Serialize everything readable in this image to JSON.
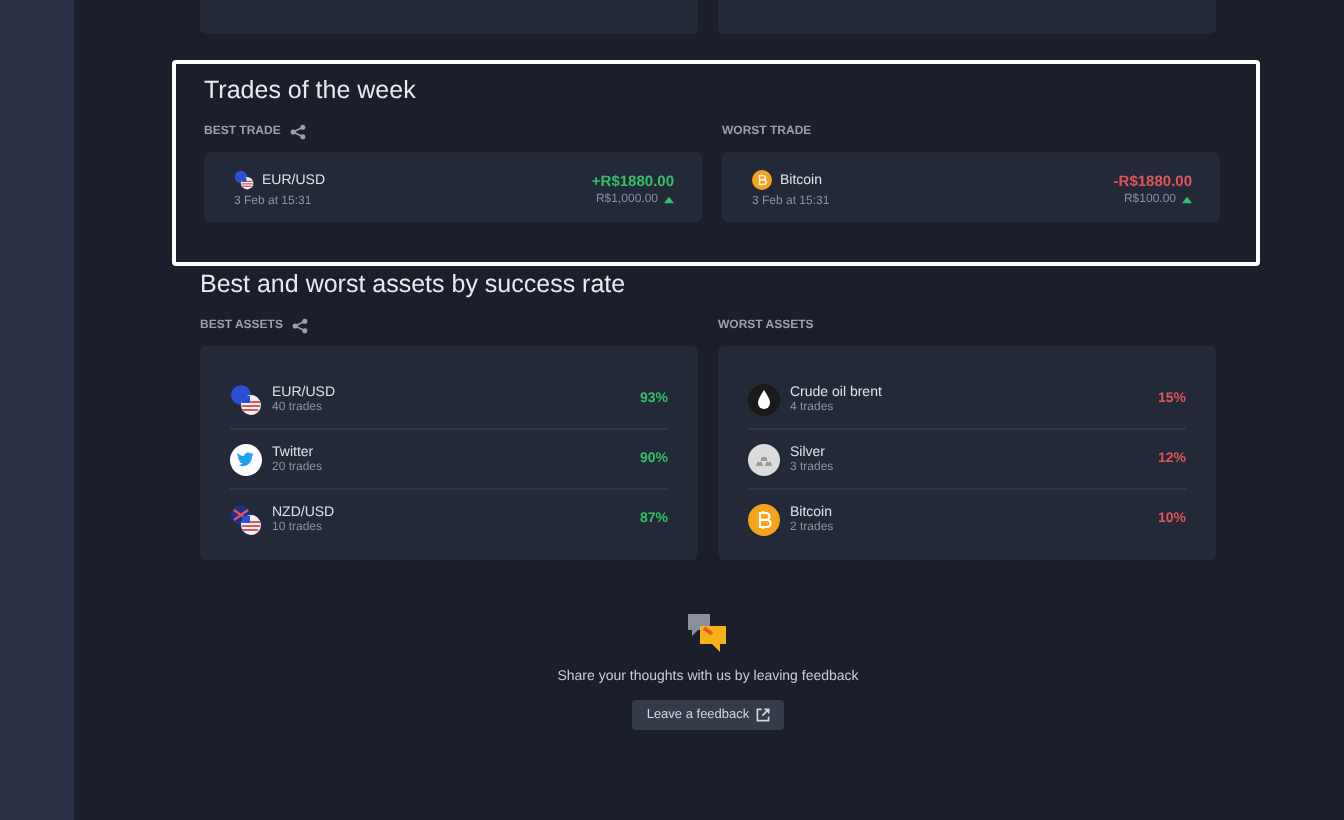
{
  "trades": {
    "title": "Trades of the week",
    "highlighted": true,
    "columns": [
      {
        "label": "BEST TRADE",
        "share": true,
        "asset": "EUR/USD",
        "kind": "eur-usd",
        "date": "3 Feb at 15:31",
        "result": "+R$1880.00",
        "positive": true,
        "amount": "R$1,000.00"
      },
      {
        "label": "WORST TRADE",
        "share": false,
        "asset": "Bitcoin",
        "kind": "bitcoin",
        "date": "3 Feb at 15:31",
        "result": "-R$1880.00",
        "positive": false,
        "amount": "R$100.00"
      }
    ]
  },
  "assets": {
    "title": "Best and worst assets by success rate",
    "columns": [
      {
        "label": "BEST ASSETS",
        "share": true,
        "positive": true,
        "items": [
          {
            "name": "EUR/USD",
            "kind": "eur-usd",
            "trades": "40 trades",
            "rate": "93%"
          },
          {
            "name": "Twitter",
            "kind": "twitter",
            "trades": "20 trades",
            "rate": "90%"
          },
          {
            "name": "NZD/USD",
            "kind": "nzd-usd",
            "trades": "10 trades",
            "rate": "87%"
          }
        ]
      },
      {
        "label": "WORST ASSETS",
        "share": false,
        "positive": false,
        "items": [
          {
            "name": "Crude oil brent",
            "kind": "oil",
            "trades": "4 trades",
            "rate": "15%"
          },
          {
            "name": "Silver",
            "kind": "silver",
            "trades": "3 trades",
            "rate": "12%"
          },
          {
            "name": "Bitcoin",
            "kind": "bitcoin",
            "trades": "2 trades",
            "rate": "10%"
          }
        ]
      }
    ]
  },
  "feedback": {
    "text": "Share your thoughts with us by leaving feedback",
    "button": "Leave a feedback"
  }
}
